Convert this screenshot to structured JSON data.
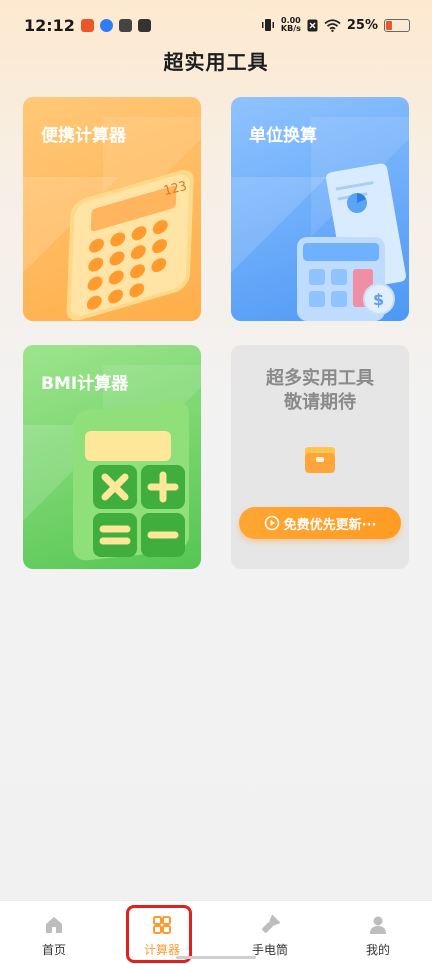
{
  "status_bar": {
    "time": "12:12",
    "net_speed_value": "0.00",
    "net_speed_unit": "KB/s",
    "battery": "25%"
  },
  "page": {
    "title": "超实用工具"
  },
  "cards": {
    "portable_calculator": {
      "title": "便携计算器",
      "display_digits": "123"
    },
    "unit_conversion": {
      "title": "单位换算"
    },
    "bmi_calculator": {
      "title": "BMI计算器"
    },
    "coming_soon": {
      "line1": "超多实用工具",
      "line2": "敬请期待",
      "button_label": "免费优先更新···"
    }
  },
  "bottom_nav": {
    "items": [
      {
        "label": "首页",
        "icon": "home-icon",
        "active": false
      },
      {
        "label": "计算器",
        "icon": "grid-icon",
        "active": true
      },
      {
        "label": "手电筒",
        "icon": "flashlight-icon",
        "active": false
      },
      {
        "label": "我的",
        "icon": "user-icon",
        "active": false
      }
    ]
  },
  "colors": {
    "accent": "#ff9a2e",
    "card_orange": "#ffae4a",
    "card_blue": "#4d98f5",
    "card_green": "#54c652",
    "highlight_box": "#e3201b"
  }
}
